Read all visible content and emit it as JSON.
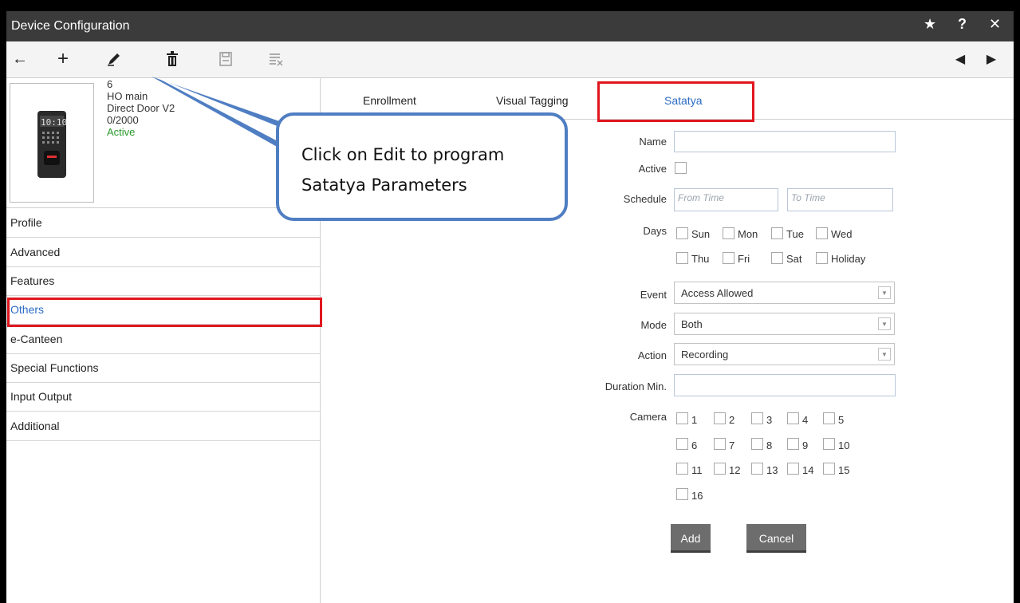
{
  "window": {
    "title": "Device Configuration"
  },
  "titlebar_controls": [
    "star-icon",
    "help-icon",
    "close-icon"
  ],
  "toolbar": {
    "buttons": [
      "back-arrow-icon",
      "add-icon",
      "edit-pencil-icon",
      "delete-trash-icon",
      "save-icon",
      "discard-icon"
    ],
    "nav": [
      "prev-icon",
      "next-icon"
    ]
  },
  "device": {
    "id": "6",
    "location": "HO main",
    "model": "Direct Door V2",
    "users": "0/2000",
    "status": "Active",
    "screen_time": "10:10"
  },
  "sidebar": {
    "items": [
      {
        "label": "Profile"
      },
      {
        "label": "Advanced"
      },
      {
        "label": "Features"
      },
      {
        "label": "Others",
        "selected": true
      },
      {
        "label": "e-Canteen"
      },
      {
        "label": "Special Functions"
      },
      {
        "label": "Input Output"
      },
      {
        "label": "Additional"
      }
    ]
  },
  "tabs": [
    {
      "label": "Enrollment"
    },
    {
      "label": "Visual Tagging"
    },
    {
      "label": "Satatya",
      "selected": true
    }
  ],
  "form": {
    "name_label": "Name",
    "name_value": "",
    "active_label": "Active",
    "schedule_label": "Schedule",
    "from_placeholder": "From Time",
    "to_placeholder": "To Time",
    "days_label": "Days",
    "days": [
      "Sun",
      "Mon",
      "Tue",
      "Wed",
      "Thu",
      "Fri",
      "Sat",
      "Holiday"
    ],
    "event_label": "Event",
    "event_value": "Access Allowed",
    "mode_label": "Mode",
    "mode_value": "Both",
    "action_label": "Action",
    "action_value": "Recording",
    "duration_label": "Duration Min.",
    "duration_value": "",
    "camera_label": "Camera",
    "cameras": [
      "1",
      "2",
      "3",
      "4",
      "5",
      "6",
      "7",
      "8",
      "9",
      "10",
      "11",
      "12",
      "13",
      "14",
      "15",
      "16"
    ],
    "add_label": "Add",
    "cancel_label": "Cancel"
  },
  "callout": {
    "line1": "Click on Edit to program",
    "line2": "Satatya Parameters"
  },
  "colors": {
    "highlight_box": "#e0161e",
    "callout_border": "#4f7ec2",
    "selected_text": "#2b6cc4",
    "active_status": "#2a9a2a"
  }
}
